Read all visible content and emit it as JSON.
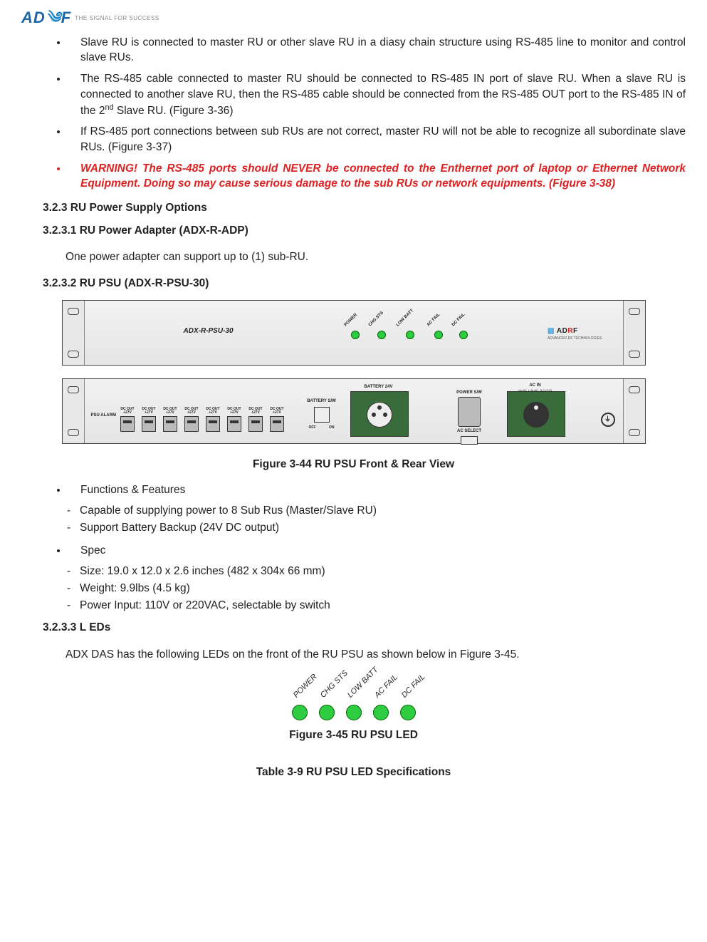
{
  "header": {
    "logo_text_a": "A",
    "logo_text_d": "D",
    "logo_text_r": "R",
    "logo_text_f": "F",
    "tagline": "THE SIGNAL FOR SUCCESS"
  },
  "bullets": [
    "Slave RU is connected to master RU or other slave RU in a diasy chain structure using RS-485 line to monitor and control slave RUs.",
    "The RS-485 cable connected to master RU should be connected to RS-485 IN port of slave RU. When a slave RU is connected to another slave RU, then the RS-485 cable should be connected from the RS-485 OUT port to the RS-485 IN of the 2nd Slave RU.  (Figure 3-36)",
    "If RS-485 port connections between sub RUs are not correct, master RU will not be able to recognize all subordinate slave RUs. (Figure 3-37)"
  ],
  "warning": "WARNING! The RS-485 ports should NEVER be connected to the Enthernet port of laptop or Ethernet Network Equipment. Doing so may cause serious damage to the sub RUs or network equipments. (Figure 3-38)",
  "sec_323": "3.2.3     RU Power Supply Options",
  "sec_3231": "3.2.3.1  RU Power Adapter (ADX-R-ADP)",
  "adapter_text": "One power adapter can support up to (1) sub-RU.",
  "sec_3232": "3.2.3.2  RU PSU (ADX-R-PSU-30)",
  "psu_front": {
    "model": "ADX-R-PSU-30",
    "leds": [
      "POWER",
      "CHG STS",
      "LOW BATT",
      "AC FAIL",
      "DC FAIL"
    ],
    "brand_a": "AD",
    "brand_r": "R",
    "brand_f": "F",
    "brand_sub": "ADVANCED RF TECHNOLOGIES"
  },
  "psu_rear": {
    "psu_alarm": "PSU ALARM",
    "dcout_lbl": "DC OUT +27V",
    "batt_sw": "BATTERY S/W",
    "off": "OFF",
    "on": "ON",
    "batt24": "BATTERY 24V",
    "pwr_sw": "POWER S/W",
    "ac_select": "AC SELECT",
    "ac_in": "AC IN",
    "ac_in_sub": "(A=AC_L,B=AC_N,C=F.G)"
  },
  "fig344": "Figure 3-44 RU PSU Front & Rear View",
  "functions_hdr": "Functions & Features",
  "functions": [
    "Capable of supplying power to 8 Sub Rus (Master/Slave RU)",
    "Support Battery Backup (24V DC output)"
  ],
  "spec_hdr": "Spec",
  "specs": [
    "Size: 19.0 x 12.0 x 2.6 inches (482 x 304x 66 mm)",
    "Weight: 9.9lbs (4.5 kg)",
    "Power Input: 110V or 220VAC, selectable by switch"
  ],
  "sec_3233": "3.2.3.3 L EDs",
  "leds_text": "ADX DAS has the following LEDs on the front of the RU PSU as shown below in Figure 3-45.",
  "led_fig_labels": [
    "POWER",
    "CHG STS",
    "LOW BATT",
    "AC FAIL",
    "DC FAIL"
  ],
  "fig345": "Figure 3-45 RU PSU LED",
  "table39": "Table 3-9    RU PSU LED Specifications"
}
